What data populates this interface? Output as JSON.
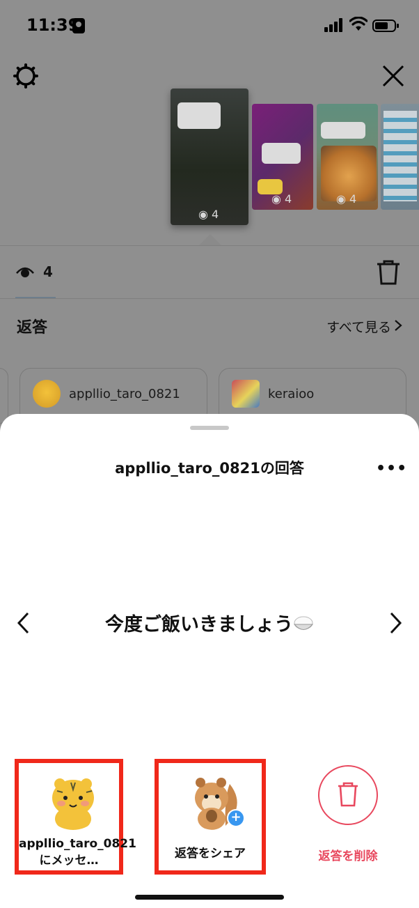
{
  "status": {
    "time": "11:39"
  },
  "thumbnails": [
    {
      "views": "4"
    },
    {
      "views": "4"
    },
    {
      "views": "4"
    }
  ],
  "viewers": {
    "count": "4"
  },
  "replies": {
    "title": "返答",
    "see_all": "すべて見る"
  },
  "reply_users": [
    {
      "name": "appllio_taro_0821"
    },
    {
      "name": "keraioo"
    }
  ],
  "sheet": {
    "title": "appllio_taro_0821の回答",
    "answer": "今度ご飯いきましょう"
  },
  "actions": {
    "message": "appllio_taro_0821にメッセ…",
    "share": "返答をシェア",
    "delete": "返答を削除"
  },
  "colors": {
    "highlight": "#f0281a",
    "delete": "#e8485e",
    "accent": "#3897f0"
  }
}
